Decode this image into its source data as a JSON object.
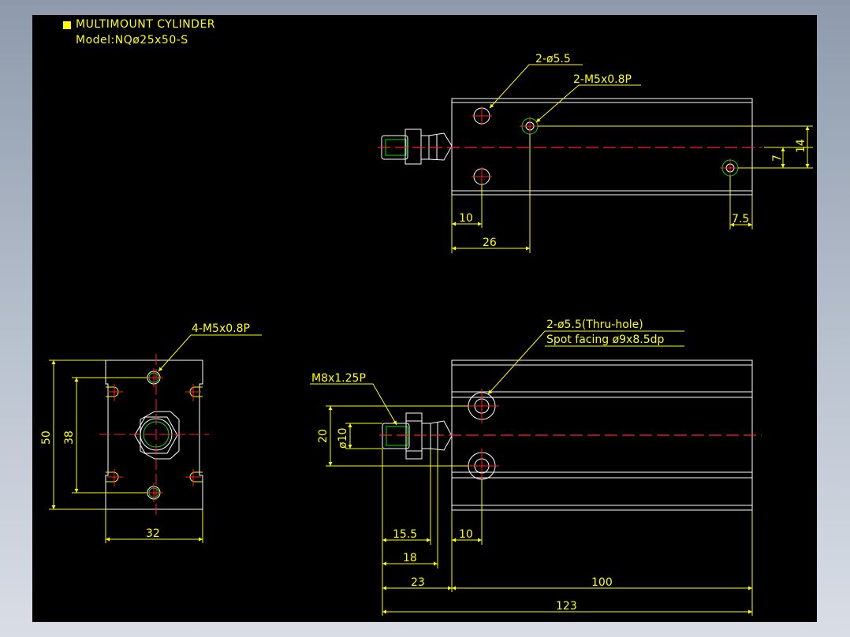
{
  "title": {
    "heading": "MULTIMOUNT CYLINDER",
    "model": "Model:NQø25x50-S"
  },
  "annotations": {
    "top_holes": "2-ø5.5",
    "top_tapped": "2-M5x0.8P",
    "front_tapped": "4-M5x0.8P",
    "thru_hole": "2-ø5.5(Thru-hole)",
    "spot_facing": "Spot facing ø9x8.5dp",
    "rod_thread": "M8x1.25P"
  },
  "dimensions": {
    "top_10": "10",
    "top_26": "26",
    "top_7_5": "7.5",
    "top_7": "7",
    "top_14": "14",
    "front_50": "50",
    "front_38": "38",
    "front_32": "32",
    "side_20": "20",
    "side_dia10": "ø10",
    "side_15_5": "15.5",
    "side_18": "18",
    "side_23": "23",
    "side_10": "10",
    "side_100": "100",
    "side_123": "123"
  },
  "colors": {
    "background": "#000000",
    "dimension": "#ffff00",
    "outline": "#ffffff",
    "centerline": "#ff2020",
    "hidden": "#00e000"
  }
}
